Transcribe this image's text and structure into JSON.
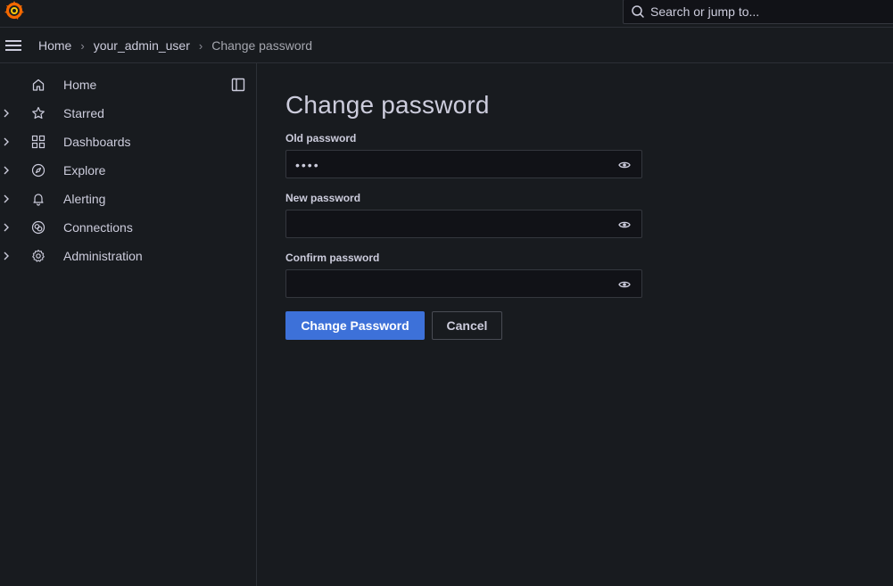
{
  "topbar": {
    "search_placeholder": "Search or jump to..."
  },
  "breadcrumb": {
    "items": [
      "Home",
      "your_admin_user",
      "Change password"
    ],
    "separator": "›"
  },
  "sidebar": {
    "items": [
      {
        "label": "Home",
        "icon": "home-icon",
        "expandable": false
      },
      {
        "label": "Starred",
        "icon": "star-icon",
        "expandable": true
      },
      {
        "label": "Dashboards",
        "icon": "apps-icon",
        "expandable": true
      },
      {
        "label": "Explore",
        "icon": "compass-icon",
        "expandable": true
      },
      {
        "label": "Alerting",
        "icon": "bell-icon",
        "expandable": true
      },
      {
        "label": "Connections",
        "icon": "connections-icon",
        "expandable": true
      },
      {
        "label": "Administration",
        "icon": "cog-icon",
        "expandable": true
      }
    ]
  },
  "form": {
    "title": "Change password",
    "old_password": {
      "label": "Old password",
      "value": "••••"
    },
    "new_password": {
      "label": "New password",
      "value": ""
    },
    "confirm_password": {
      "label": "Confirm password",
      "value": ""
    },
    "submit_label": "Change Password",
    "cancel_label": "Cancel"
  },
  "colors": {
    "background": "#181b1f",
    "input_background": "#111217",
    "primary": "#3d71d9",
    "logo": "#f46800"
  }
}
